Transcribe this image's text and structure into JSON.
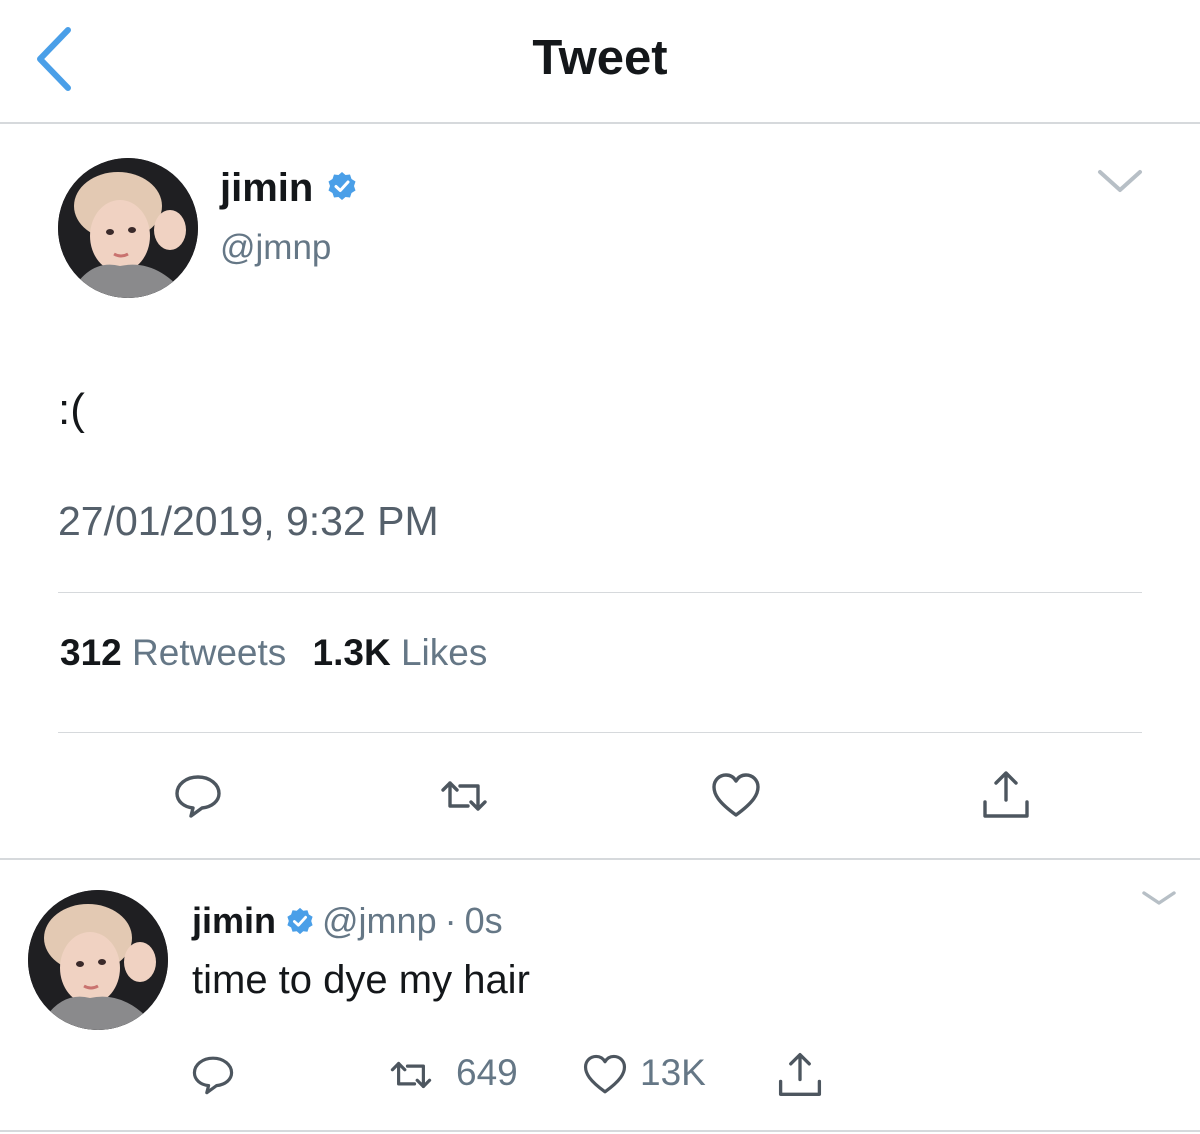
{
  "header": {
    "title": "Tweet",
    "back_icon": "chevron-left-icon"
  },
  "colors": {
    "accent": "#4a9fe8",
    "secondary_text": "#657786",
    "divider": "#d6d9dc"
  },
  "main_tweet": {
    "name": "jimin",
    "handle": "@jmnp",
    "text": ":(",
    "timestamp": "27/01/2019, 9:32 PM",
    "retweets_count": "312",
    "retweets_label": "Retweets",
    "likes_count": "1.3K",
    "likes_label": "Likes",
    "actions": [
      "reply-icon",
      "retweet-icon",
      "like-icon",
      "share-icon"
    ]
  },
  "reply_tweet": {
    "name": "jimin",
    "handle": "@jmnp",
    "separator": "·",
    "time": "0s",
    "text": "time to dye my hair",
    "retweets_count": "649",
    "likes_count": "13K"
  }
}
